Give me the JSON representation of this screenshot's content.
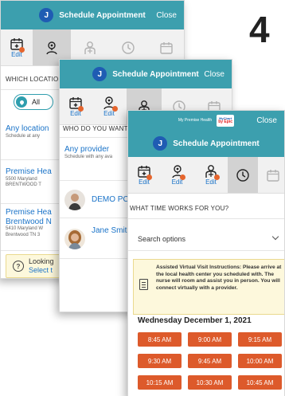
{
  "step_number": "4",
  "colors": {
    "header": "#3c9fae",
    "avatar": "#1f5cb3",
    "accent_check": "#e5652d",
    "time_button": "#dd5a2b",
    "link": "#1a73c8",
    "notice_bg": "#fdf8dc"
  },
  "screen_location": {
    "avatar_initial": "J",
    "title": "Schedule Appointment",
    "close": "Close",
    "tabs": [
      {
        "icon": "calendar-plus-icon",
        "label": "Edit",
        "done": true
      },
      {
        "icon": "location-person-icon",
        "label": "",
        "done": false
      },
      {
        "icon": "provider-icon",
        "label": "",
        "done": false
      },
      {
        "icon": "clock-icon",
        "label": "",
        "done": false
      },
      {
        "icon": "calendar-icon",
        "label": "",
        "done": false
      }
    ],
    "question": "WHICH LOCATION",
    "filter_all": "All",
    "location_cards": [
      {
        "name": "Any location",
        "lines": [
          "Schedule at any"
        ]
      },
      {
        "name": "Premise Hea",
        "lines": [
          "5500 Maryland",
          "BRENTWOOD T"
        ]
      },
      {
        "name": "Premise Hea",
        "name2": "Brentwood N",
        "lines": [
          "5410 Maryland W",
          "Brentwood TN 3"
        ]
      }
    ],
    "looking_title": "Looking",
    "looking_link": "Select t"
  },
  "screen_provider": {
    "avatar_initial": "J",
    "title": "Schedule Appointment",
    "close": "Close",
    "tabs": [
      {
        "icon": "calendar-plus-icon",
        "label": "Edit",
        "done": true
      },
      {
        "icon": "location-person-icon",
        "label": "Edit",
        "done": true
      },
      {
        "icon": "provider-icon",
        "label": "",
        "done": false
      },
      {
        "icon": "clock-icon",
        "label": "",
        "done": false
      },
      {
        "icon": "calendar-icon",
        "label": "",
        "done": false
      }
    ],
    "question": "WHO DO YOU WANT",
    "any_provider": "Any provider",
    "any_provider_sub": "Schedule with any ava",
    "providers": [
      {
        "name": "DEMO PC"
      },
      {
        "name": "Jane Smith"
      }
    ]
  },
  "screen_time": {
    "brand_text": "My Premise Health",
    "badge_line1": "MyChart",
    "badge_line2": "by Epic",
    "close": "Close",
    "avatar_initial": "J",
    "title": "Schedule Appointment",
    "tabs": [
      {
        "icon": "calendar-plus-icon",
        "label": "Edit",
        "done": true
      },
      {
        "icon": "location-person-icon",
        "label": "Edit",
        "done": true
      },
      {
        "icon": "provider-icon",
        "label": "Edit",
        "done": true
      },
      {
        "icon": "clock-icon",
        "label": "",
        "done": false
      },
      {
        "icon": "calendar-icon",
        "label": "",
        "done": false
      }
    ],
    "question": "WHAT TIME WORKS FOR YOU?",
    "search_options": "Search options",
    "instructions": "Assisted Virtual Visit Instructions: Please arrive at the local health center you scheduled with. The nurse will room and assist you in person. You will connect virtually with a provider.",
    "date": "Wednesday December 1, 2021",
    "times": [
      "8:45 AM",
      "9:00 AM",
      "9:15 AM",
      "9:30 AM",
      "9:45 AM",
      "10:00 AM",
      "10:15 AM",
      "10:30 AM",
      "10:45 AM"
    ]
  }
}
